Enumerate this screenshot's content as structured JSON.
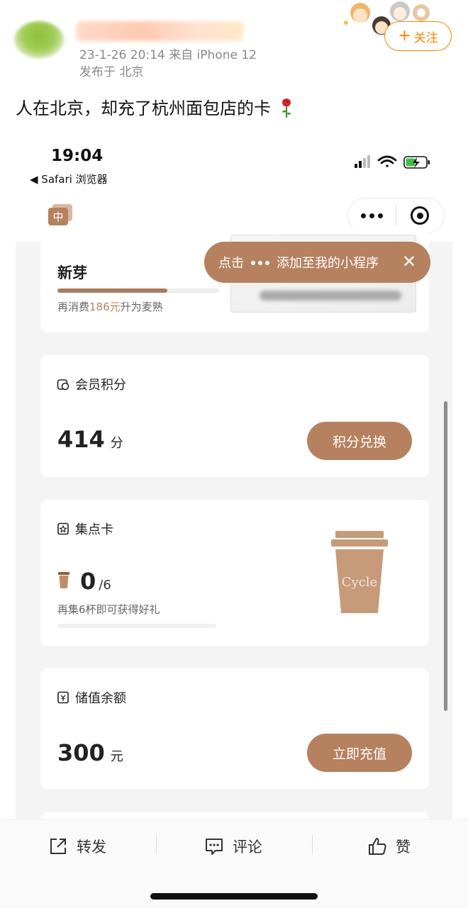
{
  "post": {
    "meta_line1": "23-1-26 20:14  来自 iPhone 12",
    "meta_line2": "发布于 北京",
    "follow_label": "关注",
    "text": "人在北京，却充了杭州面包店的卡"
  },
  "phone": {
    "time": "19:04",
    "back_app": "◀ Safari 浏览器",
    "mini_logo_text": "中"
  },
  "tip": {
    "prefix": "点击",
    "suffix": "添加至我的小程序",
    "close": "✕"
  },
  "level": {
    "name": "新芽",
    "progress": 0.68,
    "hint_prefix": "再消费",
    "hint_amount": "186元",
    "hint_suffix": "升为麦熟"
  },
  "points": {
    "title": "会员积分",
    "value": "414",
    "unit": "分",
    "button": "积分兑换"
  },
  "stamps": {
    "title": "集点卡",
    "count": "0",
    "total": "/6",
    "hint": "再集6杯即可获得好礼",
    "progress": 0,
    "cup_text": "Cycle"
  },
  "balance": {
    "title": "储值余额",
    "value": "300",
    "unit": "元",
    "button": "立即充值"
  },
  "actions": {
    "repost": "转发",
    "comment": "评论",
    "like": "赞"
  },
  "colors": {
    "accent": "#b6815f",
    "weibo_orange": "#ff8200"
  }
}
